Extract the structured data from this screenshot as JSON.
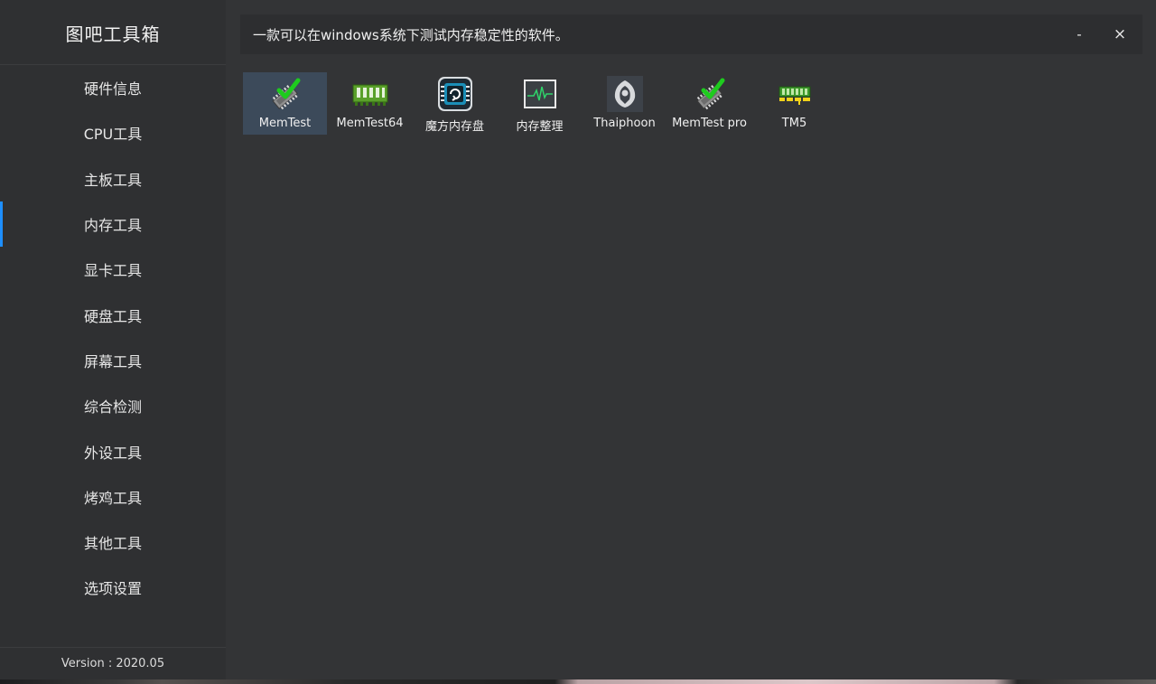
{
  "app": {
    "title": "图吧工具箱",
    "version": "Version : 2020.05"
  },
  "sidebar": {
    "items": [
      {
        "label": "硬件信息",
        "active": false
      },
      {
        "label": "CPU工具",
        "active": false
      },
      {
        "label": "主板工具",
        "active": false
      },
      {
        "label": "内存工具",
        "active": true
      },
      {
        "label": "显卡工具",
        "active": false
      },
      {
        "label": "硬盘工具",
        "active": false
      },
      {
        "label": "屏幕工具",
        "active": false
      },
      {
        "label": "综合检测",
        "active": false
      },
      {
        "label": "外设工具",
        "active": false
      },
      {
        "label": "烤鸡工具",
        "active": false
      },
      {
        "label": "其他工具",
        "active": false
      },
      {
        "label": "选项设置",
        "active": false
      }
    ]
  },
  "header": {
    "description": "一款可以在windows系统下测试内存稳定性的软件。",
    "minimize_label": "-",
    "close_label": "×"
  },
  "tools": [
    {
      "label": "MemTest",
      "icon": "memtest-checkmark-chip-icon",
      "selected": true
    },
    {
      "label": "MemTest64",
      "icon": "green-ram-module-icon",
      "selected": false
    },
    {
      "label": "魔方内存盘",
      "icon": "ram-disk-chip-icon",
      "selected": false
    },
    {
      "label": "内存整理",
      "icon": "memory-monitor-waveform-icon",
      "selected": false
    },
    {
      "label": "Thaiphoon",
      "icon": "thaiphoon-emblem-icon",
      "selected": false
    },
    {
      "label": "MemTest pro",
      "icon": "memtest-checkmark-chip-icon",
      "selected": false
    },
    {
      "label": "TM5",
      "icon": "tm5-ram-module-icon",
      "selected": false
    }
  ],
  "colors": {
    "accent": "#1e8fff",
    "selected_tile": "#3c4a5a",
    "sidebar_bg": "#2f3032",
    "main_bg": "#333436",
    "header_bg": "#2d2e30"
  }
}
